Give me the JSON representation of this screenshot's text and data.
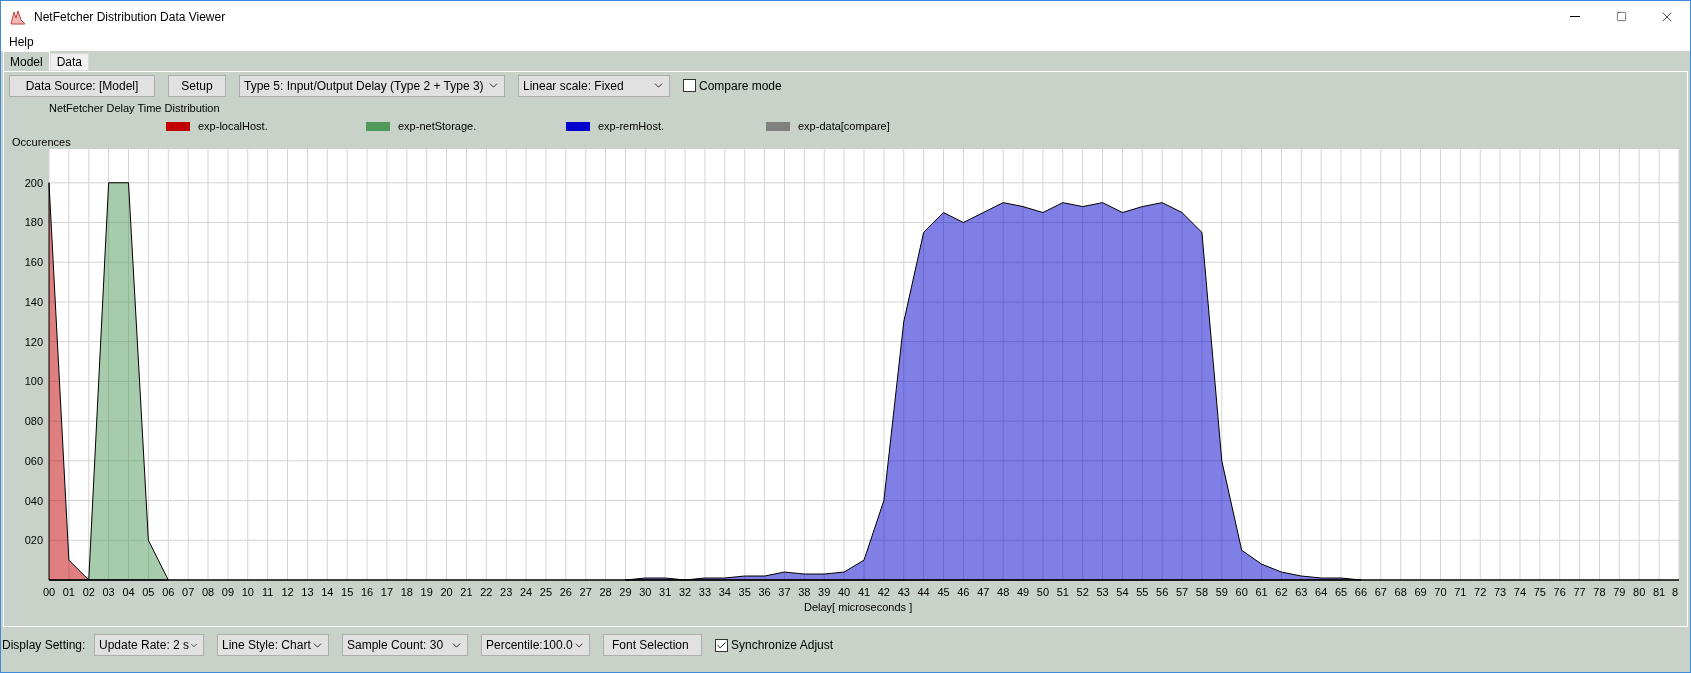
{
  "window": {
    "title": "NetFetcher Distribution Data Viewer"
  },
  "menu": [
    "Help"
  ],
  "tabs": [
    {
      "label": "Model",
      "selected": true
    },
    {
      "label": "Data",
      "selected": false
    }
  ],
  "toolbar": [
    {
      "kind": "button",
      "label": "Data Source: [Model]"
    },
    {
      "kind": "button",
      "label": "Setup"
    },
    {
      "kind": "dropdown",
      "label": "Type 5: Input/Output Delay (Type 2 + Type 3)"
    },
    {
      "kind": "dropdown",
      "label": "Linear scale: Fixed"
    },
    {
      "kind": "checkbox",
      "label": "Compare mode",
      "checked": false
    }
  ],
  "chart": {
    "compare_legend": {
      "label": "exp-data[compare]",
      "color": "#808080"
    },
    "chart_data": {
      "type": "area",
      "grid": true,
      "title": "NetFetcher Delay Time Distribution",
      "xlabel": "Delay[ microseconds ]",
      "ylabel": "Occurences",
      "categories": [
        "00",
        "01",
        "02",
        "03",
        "04",
        "05",
        "06",
        "07",
        "08",
        "09",
        "10",
        "11",
        "12",
        "13",
        "14",
        "15",
        "16",
        "17",
        "18",
        "19",
        "20",
        "21",
        "22",
        "23",
        "24",
        "25",
        "26",
        "27",
        "28",
        "29",
        "30",
        "31",
        "32",
        "33",
        "34",
        "35",
        "36",
        "37",
        "38",
        "39",
        "40",
        "41",
        "42",
        "43",
        "44",
        "45",
        "46",
        "47",
        "48",
        "49",
        "50",
        "51",
        "52",
        "53",
        "54",
        "55",
        "56",
        "57",
        "58",
        "59",
        "60",
        "61",
        "62",
        "63",
        "64",
        "65",
        "66",
        "67",
        "68",
        "69",
        "70",
        "71",
        "72",
        "73",
        "74",
        "75",
        "76",
        "77",
        "78",
        "79",
        "80",
        "81",
        "8"
      ],
      "series": [
        {
          "name": "exp-localHost.",
          "color": "#c00000",
          "values": [
            200,
            10,
            0,
            null,
            null,
            null,
            null,
            null,
            null,
            null,
            null,
            null,
            null,
            null,
            null,
            null,
            null,
            null,
            null,
            null,
            null,
            null,
            null,
            null,
            null,
            null,
            null,
            null,
            null,
            null,
            null,
            null,
            null,
            null,
            null,
            null,
            null,
            null,
            null,
            null,
            null,
            null,
            null,
            null,
            null,
            null,
            null,
            null,
            null,
            null,
            null,
            null,
            null,
            null,
            null,
            null,
            null,
            null,
            null,
            null,
            null,
            null,
            null,
            null,
            null,
            null,
            null,
            null,
            null,
            null,
            null,
            null,
            null,
            null,
            null,
            null,
            null,
            null,
            null,
            null,
            null,
            null,
            null
          ]
        },
        {
          "name": "exp-netStorage.",
          "color": "#4f9a5a",
          "values": [
            null,
            null,
            0,
            200,
            200,
            20,
            0,
            null,
            null,
            null,
            null,
            null,
            null,
            null,
            null,
            null,
            null,
            null,
            null,
            null,
            null,
            null,
            null,
            null,
            null,
            null,
            null,
            null,
            null,
            null,
            null,
            null,
            null,
            null,
            null,
            null,
            null,
            null,
            null,
            null,
            null,
            null,
            null,
            null,
            null,
            null,
            null,
            null,
            null,
            null,
            null,
            null,
            null,
            null,
            null,
            null,
            null,
            null,
            null,
            null,
            null,
            null,
            null,
            null,
            null,
            null,
            null,
            null,
            null,
            null,
            null,
            null,
            null,
            null,
            null,
            null,
            null,
            null,
            null,
            null,
            null,
            null,
            null
          ]
        },
        {
          "name": "exp-remHost.",
          "color": "#0000cc",
          "values": [
            null,
            null,
            null,
            null,
            null,
            null,
            null,
            null,
            null,
            null,
            null,
            null,
            null,
            null,
            null,
            null,
            null,
            null,
            null,
            null,
            null,
            null,
            null,
            null,
            null,
            null,
            null,
            null,
            null,
            0,
            1,
            1,
            0,
            1,
            1,
            2,
            2,
            4,
            3,
            3,
            4,
            10,
            40,
            130,
            175,
            185,
            180,
            185,
            190,
            188,
            185,
            190,
            188,
            190,
            185,
            188,
            190,
            185,
            175,
            60,
            15,
            8,
            4,
            2,
            1,
            1,
            0,
            null,
            null,
            null,
            null,
            null,
            null,
            null,
            null,
            null,
            null,
            null,
            null,
            null,
            null,
            null,
            null
          ]
        }
      ],
      "ylim": [
        0,
        217
      ],
      "yticks": [
        {
          "value": 20,
          "label": "020"
        },
        {
          "value": 40,
          "label": "040"
        },
        {
          "value": 60,
          "label": "060"
        },
        {
          "value": 80,
          "label": "080"
        },
        {
          "value": 100,
          "label": "100"
        },
        {
          "value": 120,
          "label": "120"
        },
        {
          "value": 140,
          "label": "140"
        },
        {
          "value": 160,
          "label": "160"
        },
        {
          "value": 180,
          "label": "180"
        },
        {
          "value": 200,
          "label": "200"
        }
      ]
    }
  },
  "display_settings": {
    "label": "Display Setting:",
    "controls": [
      {
        "kind": "dropdown",
        "label": "Update Rate: 2 s"
      },
      {
        "kind": "dropdown",
        "label": "Line Style: Chart"
      },
      {
        "kind": "dropdown",
        "label": "Sample Count: 30"
      },
      {
        "kind": "dropdown",
        "label": "Percentile:100.0"
      },
      {
        "kind": "flatbutton",
        "label": "Font Selection"
      },
      {
        "kind": "checkbox",
        "label": "Synchronize Adjust",
        "checked": true
      }
    ]
  }
}
